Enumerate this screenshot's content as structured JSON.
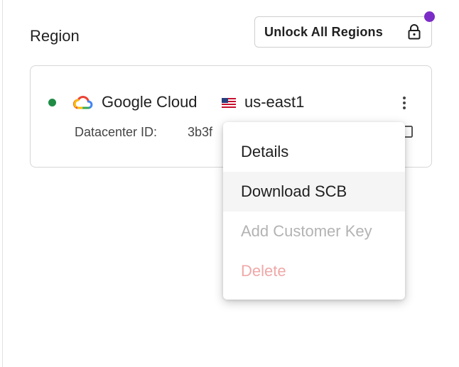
{
  "section": {
    "title": "Region"
  },
  "unlock_button": {
    "label": "Unlock All Regions",
    "icon": "lock-icon"
  },
  "notification": {
    "color": "#7b2cc6"
  },
  "region_card": {
    "status_color": "#1e8c45",
    "provider_icon": "google-cloud-icon",
    "provider": "Google Cloud",
    "flag_icon": "us-flag-icon",
    "region": "us-east1",
    "datacenter_label": "Datacenter ID:",
    "datacenter_value": "3b3f",
    "menu_icon": "more-vertical-icon",
    "copy_icon": "copy-icon"
  },
  "menu": {
    "items": [
      {
        "label": "Details",
        "enabled": true
      },
      {
        "label": "Download SCB",
        "enabled": true,
        "hovered": true
      },
      {
        "label": "Add Customer Key",
        "enabled": false
      },
      {
        "label": "Delete",
        "enabled": false,
        "destructive": true
      }
    ]
  }
}
